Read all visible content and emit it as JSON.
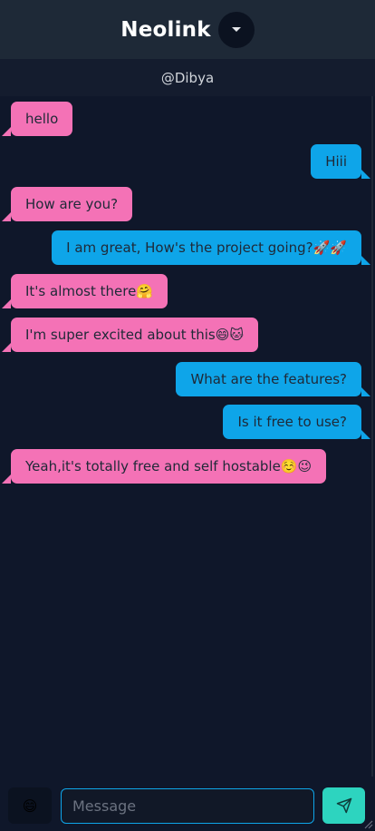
{
  "header": {
    "title": "Neolink",
    "menu_icon": "chevron-down-icon"
  },
  "chat": {
    "username": "@Dibya"
  },
  "messages": [
    {
      "dir": "in",
      "text": "hello"
    },
    {
      "dir": "out",
      "text": "Hiii"
    },
    {
      "dir": "in",
      "text": "How are you?"
    },
    {
      "dir": "out",
      "text": "I am great, How's the project going?🚀🚀"
    },
    {
      "dir": "in",
      "text": "It's almost there🤗"
    },
    {
      "dir": "in",
      "text": "I'm super excited about this😄🐱"
    },
    {
      "dir": "out",
      "text": "What are the features?"
    },
    {
      "dir": "out",
      "text": "Is it free to use?"
    },
    {
      "dir": "in",
      "text": "Yeah,it's totally free and self hostable☺️😉"
    }
  ],
  "composer": {
    "emoji": "😄",
    "placeholder": "Message",
    "value": "",
    "send_icon": "send-icon"
  },
  "colors": {
    "incoming": "#f472b6",
    "outgoing": "#0ea5e9",
    "accent": "#2dd4bf",
    "background": "#0f172a",
    "header": "#1e2937"
  }
}
